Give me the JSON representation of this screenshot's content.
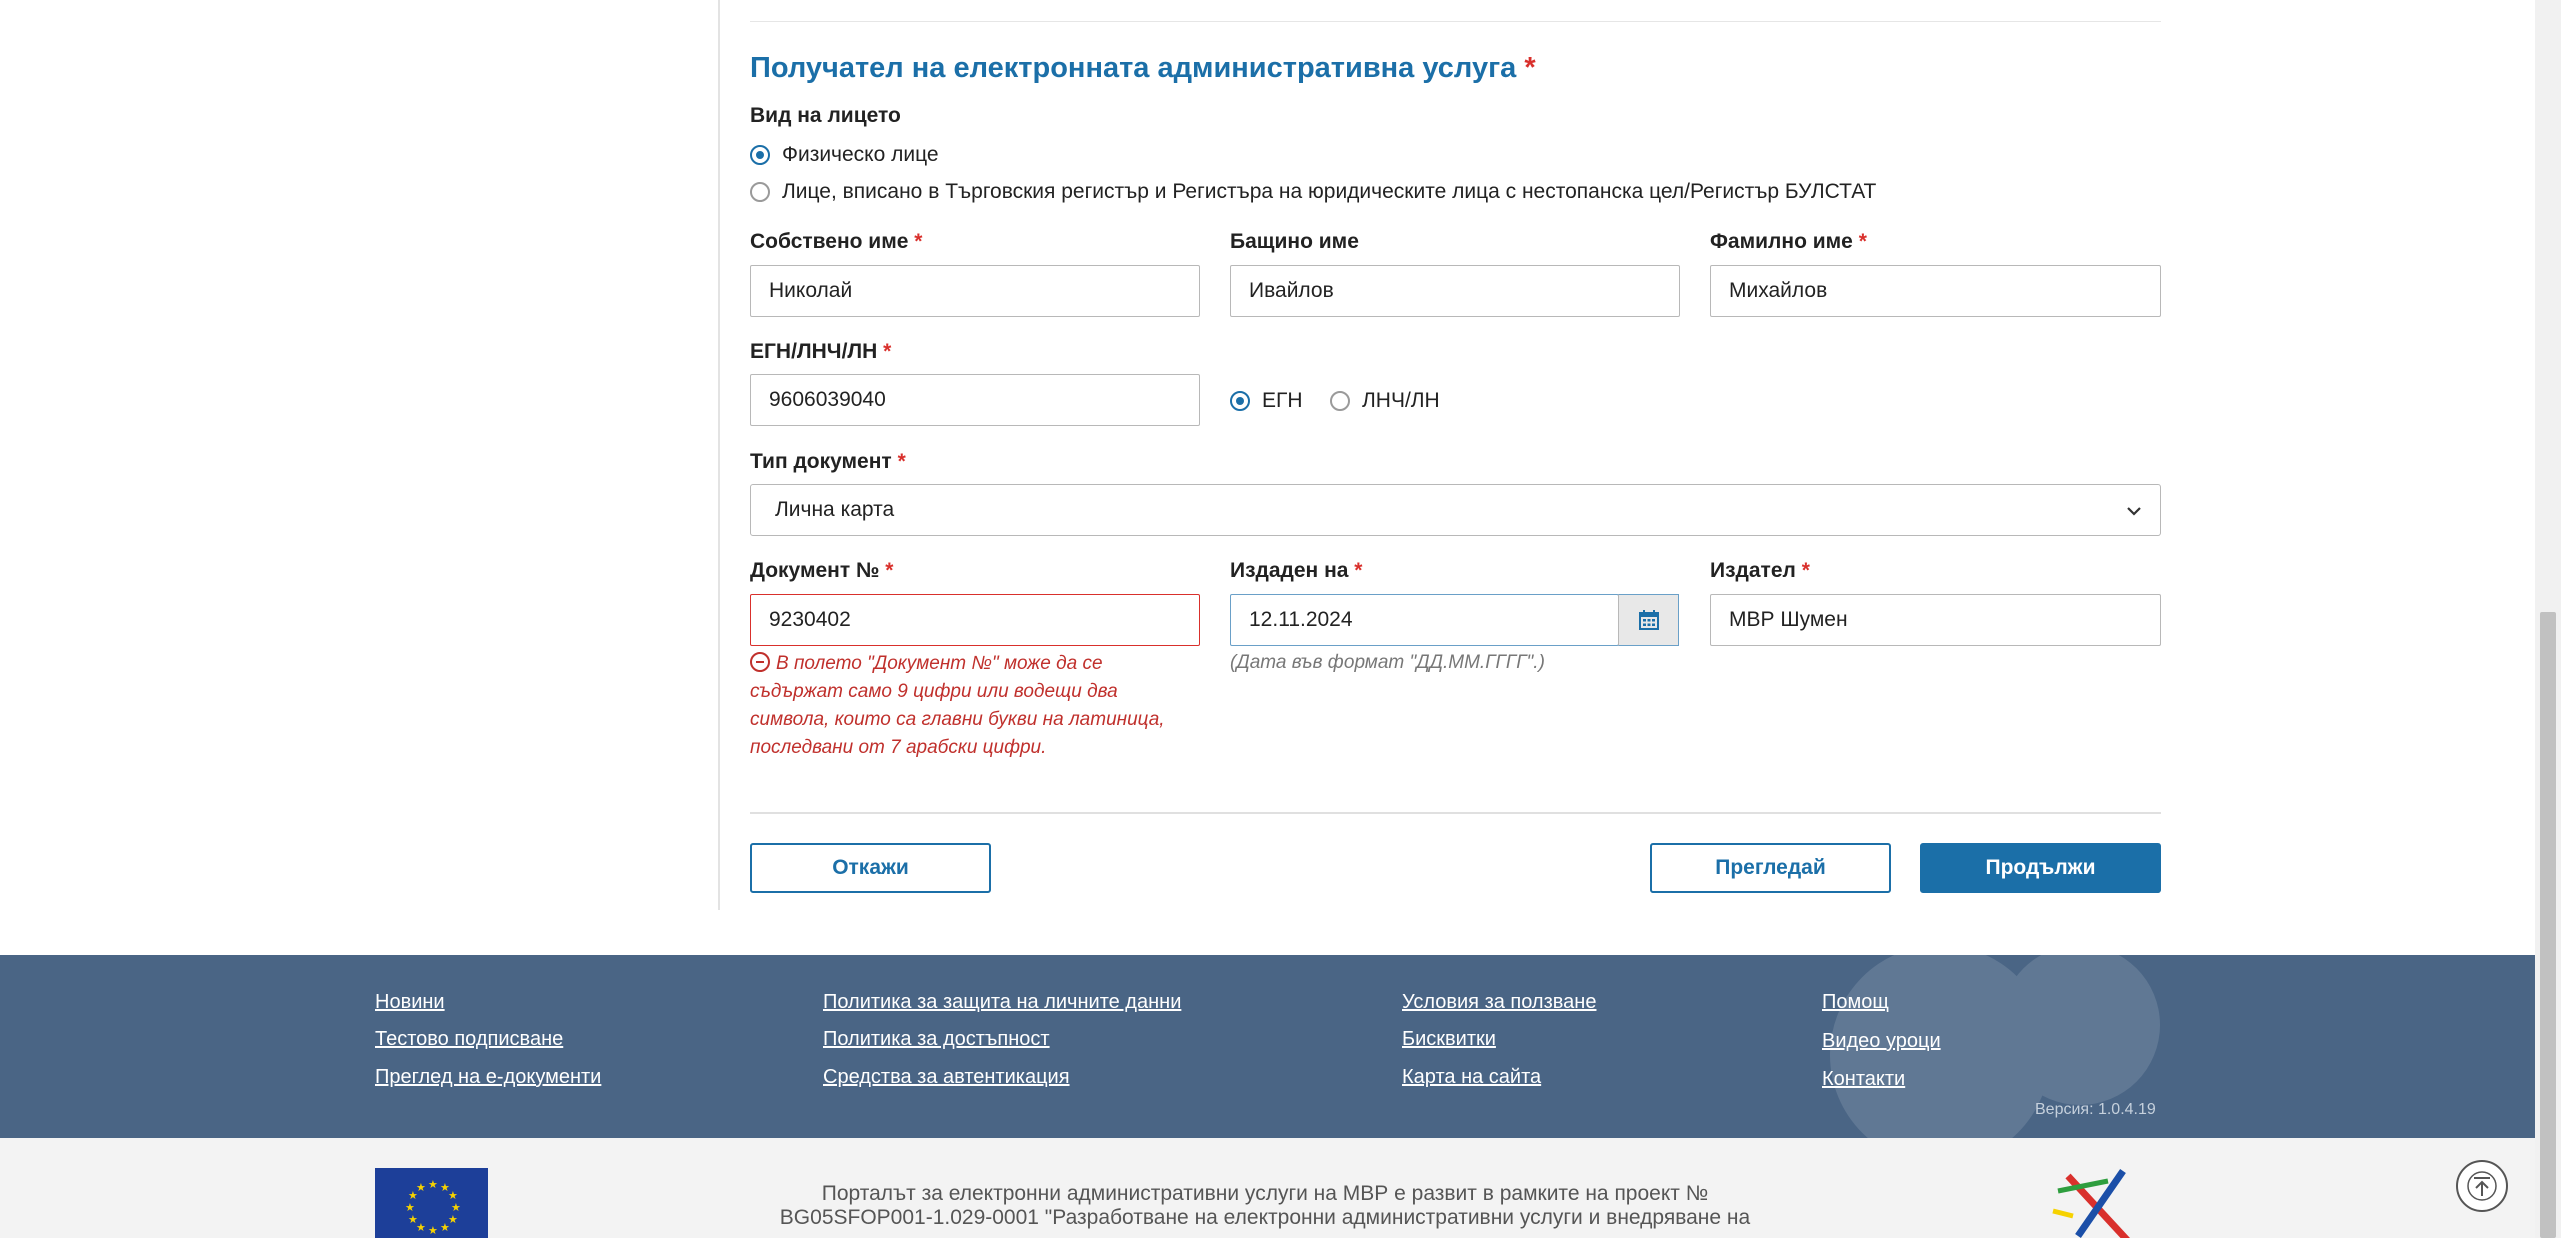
{
  "section": {
    "title": "Получател на електронната административна услуга",
    "required_mark": "*"
  },
  "person_type": {
    "label": "Вид на лицето",
    "options": [
      {
        "label": "Физическо лице",
        "checked": true
      },
      {
        "label": "Лице, вписано в Търговския регистър и Регистъра на юридическите лица с нестопанска цел/Регистър БУЛСТАТ",
        "checked": false
      }
    ]
  },
  "fields": {
    "first_name": {
      "label": "Собствено име",
      "value": "Николай",
      "required": "*"
    },
    "middle_name": {
      "label": "Бащино име",
      "value": "Ивайлов"
    },
    "last_name": {
      "label": "Фамилно име",
      "value": "Михайлов",
      "required": "*"
    },
    "egn": {
      "label": "ЕГН/ЛНЧ/ЛН",
      "value": "9606039040",
      "required": "*"
    },
    "id_type": {
      "options": [
        {
          "label": "ЕГН",
          "checked": true
        },
        {
          "label": "ЛНЧ/ЛН",
          "checked": false
        }
      ]
    },
    "doc_type": {
      "label": "Тип документ",
      "value": "Лична карта",
      "required": "*"
    },
    "doc_number": {
      "label": "Документ №",
      "value": "9230402",
      "required": "*",
      "error": "В полето \"Документ №\" може да се съдържат само 9 цифри или водещи два символа, които са главни букви на латиница, последвани от 7 арабски цифри."
    },
    "issued_on": {
      "label": "Издаден на",
      "value": "12.11.2024",
      "required": "*",
      "hint": "(Дата във формат \"ДД.ММ.ГГГГ\".)"
    },
    "issuer": {
      "label": "Издател",
      "value": "МВР Шумен",
      "required": "*"
    }
  },
  "buttons": {
    "cancel": "Откажи",
    "preview": "Прегледай",
    "continue": "Продължи"
  },
  "footer": {
    "col1": [
      "Новини",
      "Тестово подписване",
      "Преглед на е-документи"
    ],
    "col2": [
      "Политика за защита на личните данни",
      "Политика за достъпност",
      "Средства за автентикация"
    ],
    "col3": [
      "Условия за ползване",
      "Бисквитки",
      "Карта на сайта"
    ],
    "col4": [
      "Помощ",
      "Видео уроци",
      "Контакти"
    ],
    "version": "Версия: 1.0.4.19"
  },
  "bottom": {
    "text": "Порталът за електронни административни услуги на МВР е развит в рамките на проект № BG05SFOP001-1.029-0001 \"Разработване на електронни административни услуги и внедряване на"
  },
  "colors": {
    "primary": "#1b6fa8",
    "error": "#d9302c",
    "footer_bg": "#4a6585"
  }
}
